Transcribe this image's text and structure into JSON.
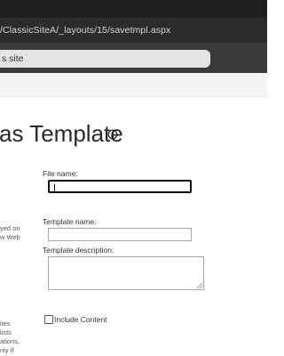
{
  "browser": {
    "url": "/ClassicSiteA/_layouts/15/savetmpl.aspx",
    "tab_label": "s site"
  },
  "page": {
    "title": "as Template"
  },
  "form": {
    "file_name_label": "File name:",
    "file_name_value": "",
    "template_name_label": "Template name:",
    "template_name_value": "",
    "template_description_label": "Template description:",
    "template_description_value": "",
    "include_content_label": "Include Content",
    "include_content_checked": false
  },
  "side_notes": {
    "block1": [
      "yed on",
      "w Web"
    ],
    "block2": [
      "ites",
      "lists",
      "ations,",
      "nly if"
    ]
  }
}
